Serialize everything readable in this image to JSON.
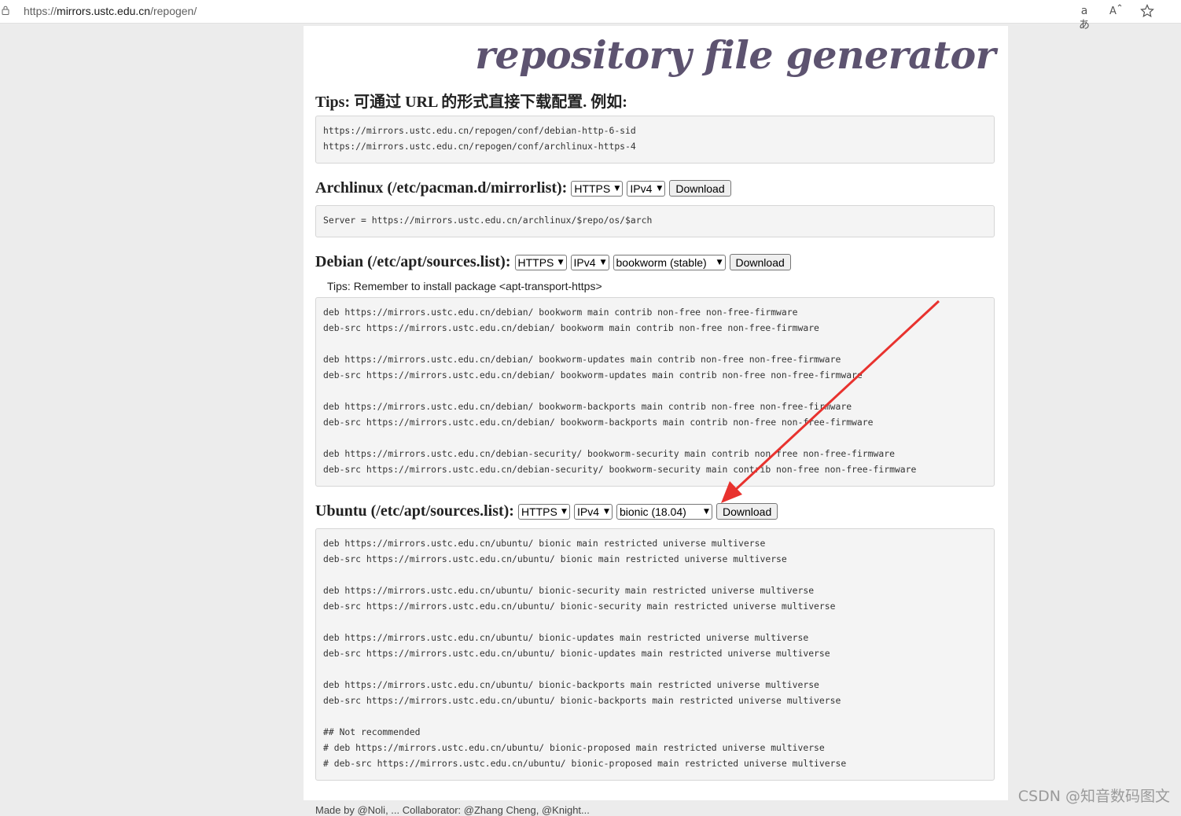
{
  "browser": {
    "url_scheme": "https://",
    "url_host": "mirrors.ustc.edu.cn",
    "url_path": "/repogen/",
    "icons": [
      "lock-icon",
      "read-aloud-translate-icon",
      "font-size-icon",
      "favorite-star-icon"
    ],
    "translate_glyph": "aあ",
    "read_glyph": "A̅"
  },
  "page": {
    "title": "repository file generator",
    "tips_heading": "Tips: 可通过 URL 的形式直接下载配置. 例如:",
    "tips_lines": [
      "https://mirrors.ustc.edu.cn/repogen/conf/debian-http-6-sid",
      "https://mirrors.ustc.edu.cn/repogen/conf/archlinux-https-4"
    ],
    "archlinux": {
      "heading": "Archlinux (/etc/pacman.d/mirrorlist):",
      "protocol": "HTTPS",
      "ipver": "IPv4",
      "download": "Download",
      "lines": [
        "Server = https://mirrors.ustc.edu.cn/archlinux/$repo/os/$arch"
      ]
    },
    "debian": {
      "heading": "Debian (/etc/apt/sources.list):",
      "protocol": "HTTPS",
      "ipver": "IPv4",
      "release": "bookworm (stable)",
      "download": "Download",
      "tip": "Tips: Remember to install package <apt-transport-https>",
      "lines": [
        "deb https://mirrors.ustc.edu.cn/debian/ bookworm main contrib non-free non-free-firmware",
        "deb-src https://mirrors.ustc.edu.cn/debian/ bookworm main contrib non-free non-free-firmware",
        "",
        "deb https://mirrors.ustc.edu.cn/debian/ bookworm-updates main contrib non-free non-free-firmware",
        "deb-src https://mirrors.ustc.edu.cn/debian/ bookworm-updates main contrib non-free non-free-firmware",
        "",
        "deb https://mirrors.ustc.edu.cn/debian/ bookworm-backports main contrib non-free non-free-firmware",
        "deb-src https://mirrors.ustc.edu.cn/debian/ bookworm-backports main contrib non-free non-free-firmware",
        "",
        "deb https://mirrors.ustc.edu.cn/debian-security/ bookworm-security main contrib non-free non-free-firmware",
        "deb-src https://mirrors.ustc.edu.cn/debian-security/ bookworm-security main contrib non-free non-free-firmware"
      ]
    },
    "ubuntu": {
      "heading": "Ubuntu (/etc/apt/sources.list):",
      "protocol": "HTTPS",
      "ipver": "IPv4",
      "release": "bionic (18.04)",
      "download": "Download",
      "lines": [
        "deb https://mirrors.ustc.edu.cn/ubuntu/ bionic main restricted universe multiverse",
        "deb-src https://mirrors.ustc.edu.cn/ubuntu/ bionic main restricted universe multiverse",
        "",
        "deb https://mirrors.ustc.edu.cn/ubuntu/ bionic-security main restricted universe multiverse",
        "deb-src https://mirrors.ustc.edu.cn/ubuntu/ bionic-security main restricted universe multiverse",
        "",
        "deb https://mirrors.ustc.edu.cn/ubuntu/ bionic-updates main restricted universe multiverse",
        "deb-src https://mirrors.ustc.edu.cn/ubuntu/ bionic-updates main restricted universe multiverse",
        "",
        "deb https://mirrors.ustc.edu.cn/ubuntu/ bionic-backports main restricted universe multiverse",
        "deb-src https://mirrors.ustc.edu.cn/ubuntu/ bionic-backports main restricted universe multiverse",
        "",
        "## Not recommended",
        "# deb https://mirrors.ustc.edu.cn/ubuntu/ bionic-proposed main restricted universe multiverse",
        "# deb-src https://mirrors.ustc.edu.cn/ubuntu/ bionic-proposed main restricted universe multiverse"
      ]
    },
    "footer": "Made by @Noli, ... Collaborator: @Zhang Cheng, @Knight..."
  },
  "annotation": {
    "arrow_color": "#e8322e"
  },
  "watermark": "CSDN @知音数码图文",
  "colors": {
    "title": "#5d5370",
    "page_bg": "#ffffff",
    "outer_bg": "#ececec",
    "code_bg": "#f4f4f4"
  }
}
